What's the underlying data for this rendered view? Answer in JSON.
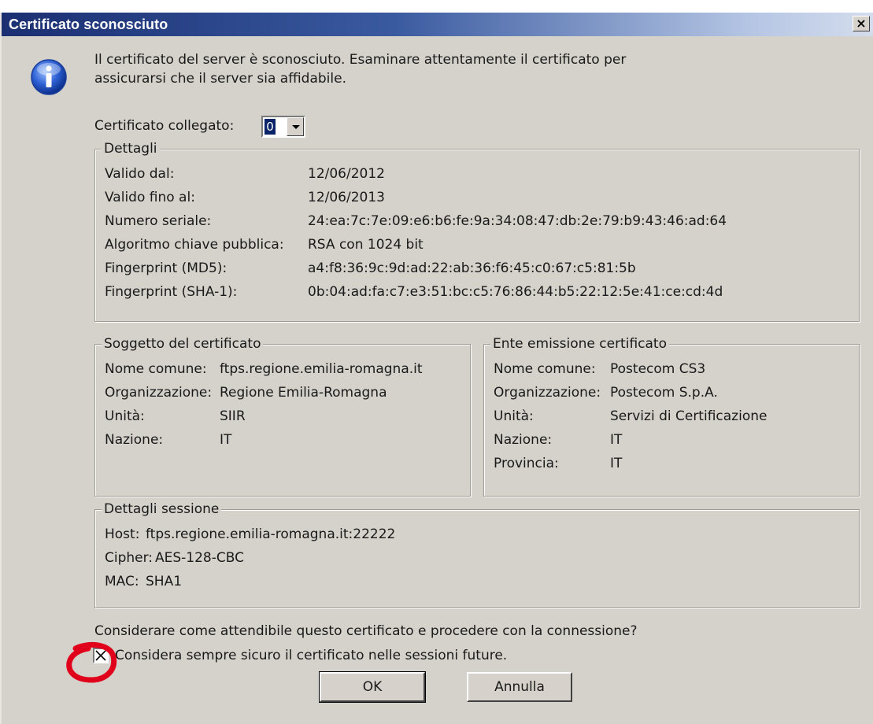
{
  "window": {
    "title": "Certificato sconosciuto",
    "close_label": "×"
  },
  "message": {
    "line1": "Il certificato del server è sconosciuto. Esaminare attentamente il certificato per",
    "line2": "assicurarsi che il server sia affidabile."
  },
  "linked_certificate": {
    "label": "Certificato collegato:",
    "value": "0"
  },
  "details": {
    "legend": "Dettagli",
    "rows": [
      {
        "label": "Valido dal:",
        "value": "12/06/2012"
      },
      {
        "label": "Valido fino al:",
        "value": "12/06/2013"
      },
      {
        "label": "Numero seriale:",
        "value": "24:ea:7c:7e:09:e6:b6:fe:9a:34:08:47:db:2e:79:b9:43:46:ad:64"
      },
      {
        "label": "Algoritmo chiave pubblica:",
        "value": "RSA con 1024 bit"
      },
      {
        "label": "Fingerprint (MD5):",
        "value": "a4:f8:36:9c:9d:ad:22:ab:36:f6:45:c0:67:c5:81:5b"
      },
      {
        "label": "Fingerprint (SHA-1):",
        "value": "0b:04:ad:fa:c7:e3:51:bc:c5:76:86:44:b5:22:12:5e:41:ce:cd:4d"
      }
    ]
  },
  "subject": {
    "legend": "Soggetto del certificato",
    "rows": [
      {
        "label": "Nome comune:",
        "value": "ftps.regione.emilia-romagna.it"
      },
      {
        "label": "Organizzazione:",
        "value": "Regione Emilia-Romagna"
      },
      {
        "label": "Unità:",
        "value": "SIIR"
      },
      {
        "label": "Nazione:",
        "value": "IT"
      }
    ]
  },
  "issuer": {
    "legend": "Ente emissione certificato",
    "rows": [
      {
        "label": "Nome comune:",
        "value": "Postecom CS3"
      },
      {
        "label": "Organizzazione:",
        "value": "Postecom S.p.A."
      },
      {
        "label": "Unità:",
        "value": "Servizi di Certificazione"
      },
      {
        "label": "Nazione:",
        "value": "IT"
      },
      {
        "label": "Provincia:",
        "value": "IT"
      }
    ]
  },
  "session": {
    "legend": "Dettagli sessione",
    "rows": [
      {
        "label": "Host:",
        "value": "ftps.regione.emilia-romagna.it:22222"
      },
      {
        "label": "Cipher:",
        "value": "AES-128-CBC"
      },
      {
        "label": "MAC:",
        "value": "SHA1"
      }
    ]
  },
  "question": "Considerare come attendibile questo certificato e procedere con la connessione?",
  "always_trust": {
    "label": "Considera sempre sicuro il certificato nelle sessioni future.",
    "checked": true
  },
  "buttons": {
    "ok": "OK",
    "cancel": "Annulla"
  },
  "colors": {
    "title_bar_start": "#1b2f72",
    "dialog_bg": "#d5d1cb",
    "annotation_red": "#e0001b"
  },
  "icons": {
    "info": "info-icon",
    "close": "close-icon",
    "dropdown": "chevron-down-icon",
    "checkbox": "checkbox-checked-icon"
  }
}
